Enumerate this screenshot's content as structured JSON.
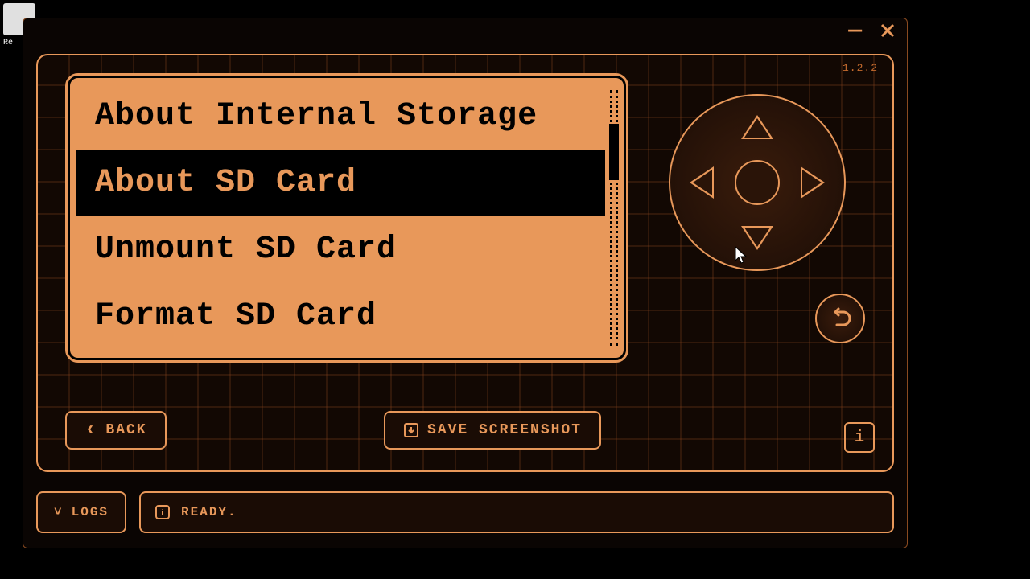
{
  "colors": {
    "accent": "#e8985a",
    "bg": "#0a0503"
  },
  "version": "1.2.2",
  "menu": {
    "items": [
      {
        "label": "About Internal Storage",
        "selected": false
      },
      {
        "label": "About SD Card",
        "selected": true
      },
      {
        "label": "Unmount SD Card",
        "selected": false
      },
      {
        "label": "Format SD Card",
        "selected": false
      }
    ]
  },
  "buttons": {
    "back": "BACK",
    "screenshot": "SAVE SCREENSHOT",
    "logs": "LOGS"
  },
  "status": {
    "text": "READY."
  },
  "icons": {
    "chevron_left": "‹",
    "chevron_down": "˅",
    "info_i": "i",
    "save": "💾"
  }
}
